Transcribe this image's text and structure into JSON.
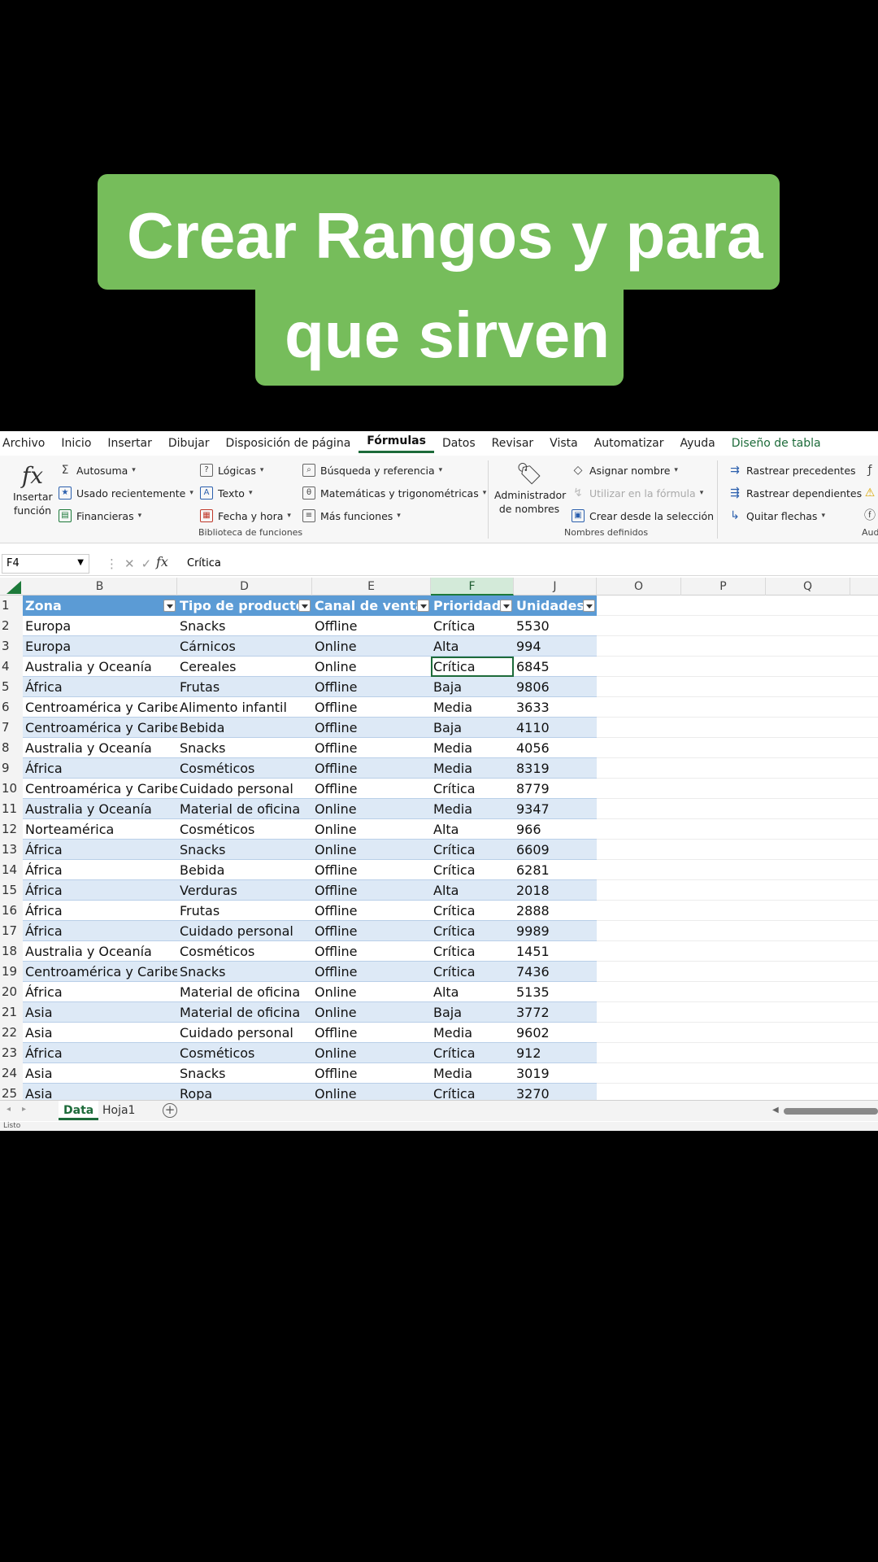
{
  "title": {
    "line1": "Crear Rangos y para",
    "line2": "que sirven"
  },
  "colors": {
    "title_bg": "#76bd5b",
    "table_header": "#5b9bd5",
    "table_band": "#dde9f6",
    "excel_green": "#1d6b3a"
  },
  "menu": [
    "Archivo",
    "Inicio",
    "Insertar",
    "Dibujar",
    "Disposición de página",
    "Fórmulas",
    "Datos",
    "Revisar",
    "Vista",
    "Automatizar",
    "Ayuda",
    "Diseño de tabla"
  ],
  "ribbon": {
    "insert_function": "Insertar función",
    "autosum": "Autosuma",
    "recent": "Usado recientemente",
    "financial": "Financieras",
    "logical": "Lógicas",
    "text": "Texto",
    "datetime": "Fecha y hora",
    "lookup": "Búsqueda y referencia",
    "math": "Matemáticas y trigonométricas",
    "more": "Más funciones",
    "library_label": "Biblioteca de funciones",
    "name_manager": "Administrador de nombres",
    "define_name": "Asignar nombre",
    "use_in_formula": "Utilizar en la fórmula",
    "create_from_selection": "Crear desde la selección",
    "names_label": "Nombres definidos",
    "trace_precedents": "Rastrear precedentes",
    "trace_dependents": "Rastrear dependientes",
    "remove_arrows": "Quitar flechas",
    "audit_label": "Aud"
  },
  "formula_bar": {
    "name_box": "F4",
    "fx": "fx",
    "value": "Crítica"
  },
  "columns": [
    "B",
    "D",
    "E",
    "F",
    "J",
    "O",
    "P",
    "Q"
  ],
  "table": {
    "headers": [
      "Zona",
      "Tipo de producto",
      "Canal de venta",
      "Prioridad",
      "Unidades"
    ],
    "rows": [
      [
        "Europa",
        "Snacks",
        "Offline",
        "Crítica",
        "5530"
      ],
      [
        "Europa",
        "Cárnicos",
        "Online",
        "Alta",
        "994"
      ],
      [
        "Australia y Oceanía",
        "Cereales",
        "Online",
        "Crítica",
        "6845"
      ],
      [
        "África",
        "Frutas",
        "Offline",
        "Baja",
        "9806"
      ],
      [
        "Centroamérica y Caribe",
        "Alimento infantil",
        "Offline",
        "Media",
        "3633"
      ],
      [
        "Centroamérica y Caribe",
        "Bebida",
        "Offline",
        "Baja",
        "4110"
      ],
      [
        "Australia y Oceanía",
        "Snacks",
        "Offline",
        "Media",
        "4056"
      ],
      [
        "África",
        "Cosméticos",
        "Offline",
        "Media",
        "8319"
      ],
      [
        "Centroamérica y Caribe",
        "Cuidado personal",
        "Offline",
        "Crítica",
        "8779"
      ],
      [
        "Australia y Oceanía",
        "Material de oficina",
        "Online",
        "Media",
        "9347"
      ],
      [
        "Norteamérica",
        "Cosméticos",
        "Online",
        "Alta",
        "966"
      ],
      [
        "África",
        "Snacks",
        "Online",
        "Crítica",
        "6609"
      ],
      [
        "África",
        "Bebida",
        "Offline",
        "Crítica",
        "6281"
      ],
      [
        "África",
        "Verduras",
        "Offline",
        "Alta",
        "2018"
      ],
      [
        "África",
        "Frutas",
        "Offline",
        "Crítica",
        "2888"
      ],
      [
        "África",
        "Cuidado personal",
        "Offline",
        "Crítica",
        "9989"
      ],
      [
        "Australia y Oceanía",
        "Cosméticos",
        "Offline",
        "Crítica",
        "1451"
      ],
      [
        "Centroamérica y Caribe",
        "Snacks",
        "Offline",
        "Crítica",
        "7436"
      ],
      [
        "África",
        "Material de oficina",
        "Online",
        "Alta",
        "5135"
      ],
      [
        "Asia",
        "Material de oficina",
        "Online",
        "Baja",
        "3772"
      ],
      [
        "Asia",
        "Cuidado personal",
        "Offline",
        "Media",
        "9602"
      ],
      [
        "África",
        "Cosméticos",
        "Online",
        "Crítica",
        "912"
      ],
      [
        "Asia",
        "Snacks",
        "Offline",
        "Media",
        "3019"
      ],
      [
        "Asia",
        "Ropa",
        "Online",
        "Crítica",
        "3270"
      ]
    ]
  },
  "sheets": [
    "Data",
    "Hoja1"
  ],
  "status": "Listo"
}
